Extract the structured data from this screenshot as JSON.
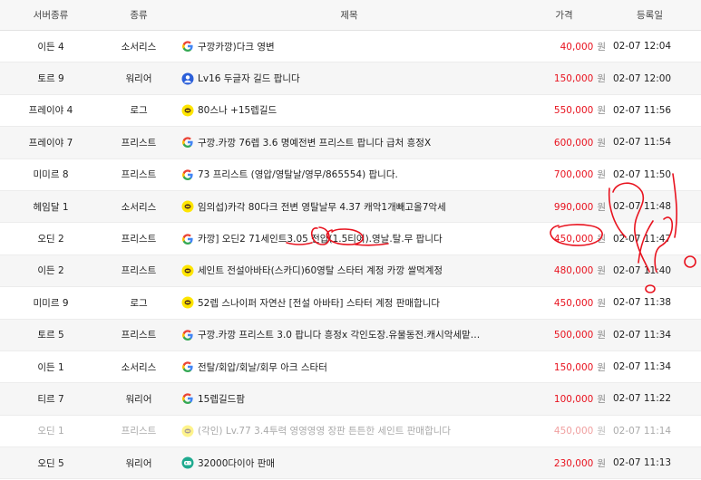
{
  "headers": {
    "server": "서버종류",
    "class": "종류",
    "title": "제목",
    "price": "가격",
    "date": "등록일"
  },
  "currency": "원",
  "rows": [
    {
      "server": "이든 4",
      "class": "소서리스",
      "icon": "google-icon",
      "title": "구깡카깡)다크 영변",
      "price": "40,000",
      "date": "02-07 12:04",
      "dim": false
    },
    {
      "server": "토르 9",
      "class": "워리어",
      "icon": "user-circle-icon",
      "title": "Lv16 두글자 길드 팝니다",
      "price": "150,000",
      "date": "02-07 12:00",
      "dim": false
    },
    {
      "server": "프레이야 4",
      "class": "로그",
      "icon": "kakao-icon",
      "title": "80스나 +15렙길드",
      "price": "550,000",
      "date": "02-07 11:56",
      "dim": false
    },
    {
      "server": "프레이야 7",
      "class": "프리스트",
      "icon": "google-icon",
      "title": "구깡.카깡 76렙 3.6 명예전변 프리스트 팝니다 급처 흥정X",
      "price": "600,000",
      "date": "02-07 11:54",
      "dim": false
    },
    {
      "server": "미미르 8",
      "class": "프리스트",
      "icon": "google-icon",
      "title": "73 프리스트 (영압/영탈날/영무/865554) 팝니다.",
      "price": "700,000",
      "date": "02-07 11:50",
      "dim": false
    },
    {
      "server": "헤임달 1",
      "class": "소서리스",
      "icon": "kakao-icon",
      "title": "임의섭)카각 80다크 전변 영탈날무 4.37 캐악1개빼고올7악세",
      "price": "990,000",
      "date": "02-07 11:48",
      "dim": false
    },
    {
      "server": "오딘 2",
      "class": "프리스트",
      "icon": "google-icon",
      "title": "카깡] 오딘2 71세인트3.05 전압(1.5티어).영날.탈.무 팝니다",
      "price": "450,000",
      "date": "02-07 11:47",
      "dim": false
    },
    {
      "server": "이든 2",
      "class": "프리스트",
      "icon": "kakao-icon",
      "title": "세인트 전설아바타(스카디)60영탈 스타터 계정 카깡 쌀먹계정",
      "price": "480,000",
      "date": "02-07 11:40",
      "dim": false
    },
    {
      "server": "미미르 9",
      "class": "로그",
      "icon": "kakao-icon",
      "title": "52렙 스나이퍼 자연산 [전설 아바타] 스타터 계정 판매합니다",
      "price": "450,000",
      "date": "02-07 11:38",
      "dim": false
    },
    {
      "server": "토르 5",
      "class": "프리스트",
      "icon": "google-icon",
      "title": "구깡.카깡 프리스트 3.0 팝니다 흥정x 각인도장.유물동전.캐시악세맡…",
      "price": "500,000",
      "date": "02-07 11:34",
      "dim": false
    },
    {
      "server": "이든 1",
      "class": "소서리스",
      "icon": "google-icon",
      "title": "전탈/회압/회날/회무 아크 스타터",
      "price": "150,000",
      "date": "02-07 11:34",
      "dim": false
    },
    {
      "server": "티르 7",
      "class": "워리어",
      "icon": "google-icon",
      "title": "15렙길드팜",
      "price": "100,000",
      "date": "02-07 11:22",
      "dim": false
    },
    {
      "server": "오딘 1",
      "class": "프리스트",
      "icon": "kakao-icon",
      "title": "(각인) Lv.77 3.4투력 영영영영 장판 튼튼한 세인트 판매합니다",
      "price": "450,000",
      "date": "02-07 11:14",
      "dim": true
    },
    {
      "server": "오딘 5",
      "class": "워리어",
      "icon": "gamepad-icon",
      "title": "32000다이아 판매",
      "price": "230,000",
      "date": "02-07 11:13",
      "dim": false
    }
  ],
  "colors": {
    "price": "#e8131f",
    "annotation": "#e8131f",
    "header_bg": "#f7f7f7"
  }
}
